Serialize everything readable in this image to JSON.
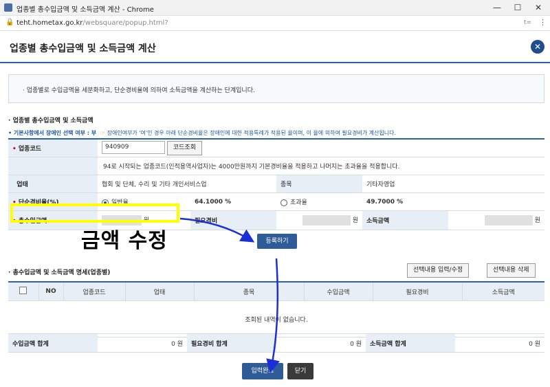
{
  "browser": {
    "title": "업종별 총수입금액 및 소득금액 계산 - Chrome",
    "url_domain": "teht.hometax.go.kr",
    "url_path": "/websquare/popup.html?",
    "minimize": "—",
    "maximize": "☐",
    "close": "✕",
    "translate": "t=",
    "menu": "⋮"
  },
  "popup": {
    "title": "업종별 총수입금액 및 소득금액 계산",
    "close_label": "✕",
    "info": "업종별로 수입금액을 세분화하고, 단순경비율에 의하여 소득금액을 계산하는 단계입니다."
  },
  "form": {
    "section_title": "업종별 총수입금액 및 소득금액",
    "note_label": "기본사항에서 장애인 선택 여부 : 부",
    "note_rest": "장애인여부가 '여'인 경우 아래 단순경비율은 장애인에 대한 적용특례가 적용된 율이며, 이 율에 의하여 필요경비가 계산됩니다.",
    "industry_code_label": "업종코드",
    "industry_code_value": "940909",
    "lookup_button": "코드조회",
    "industry_note": "94로 시작되는 업종코드(인적용역사업자)는 4000만원까지 기본경비율을 적용하고 나머지는 초과율을 적용합니다.",
    "business_type_label": "업태",
    "business_type_value": "협회 및 단체, 수리 및 기타 개인서비스업",
    "category_label": "종목",
    "category_value": "기타자영업",
    "rate_label": "단순경비율(%)",
    "general_rate_label": "일반율",
    "general_rate_value": "64.1000 %",
    "excess_rate_label": "초과율",
    "excess_rate_value": "49.7000 %",
    "revenue_label": "총수입금액",
    "won": "원",
    "expense_label": "필요경비",
    "income_label": "소득금액",
    "register_button": "등록하기",
    "annotation": "금액 수정"
  },
  "list": {
    "section_title": "총수입금액 및 소득금액 명세(업종별)",
    "edit_button": "선택내용 입력/수정",
    "delete_button": "선택내용 삭제",
    "columns": [
      "NO",
      "업종코드",
      "업태",
      "종목",
      "수입금액",
      "필요경비",
      "소득금액"
    ],
    "empty_message": "조회된 내역이 없습니다."
  },
  "summary": {
    "revenue_total_label": "수입금액 합계",
    "revenue_total_value": "0 원",
    "expense_total_label": "필요경비 합계",
    "expense_total_value": "0 원",
    "income_total_label": "소득금액 합계",
    "income_total_value": "0 원"
  },
  "footer": {
    "submit_button": "입력완료",
    "close_button": "닫기"
  },
  "colors": {
    "accent": "#2a62a8",
    "button_blue": "#2f5b97",
    "highlight": "#ffff00",
    "required": "#d0021b",
    "arrow": "#1b2fd6"
  }
}
